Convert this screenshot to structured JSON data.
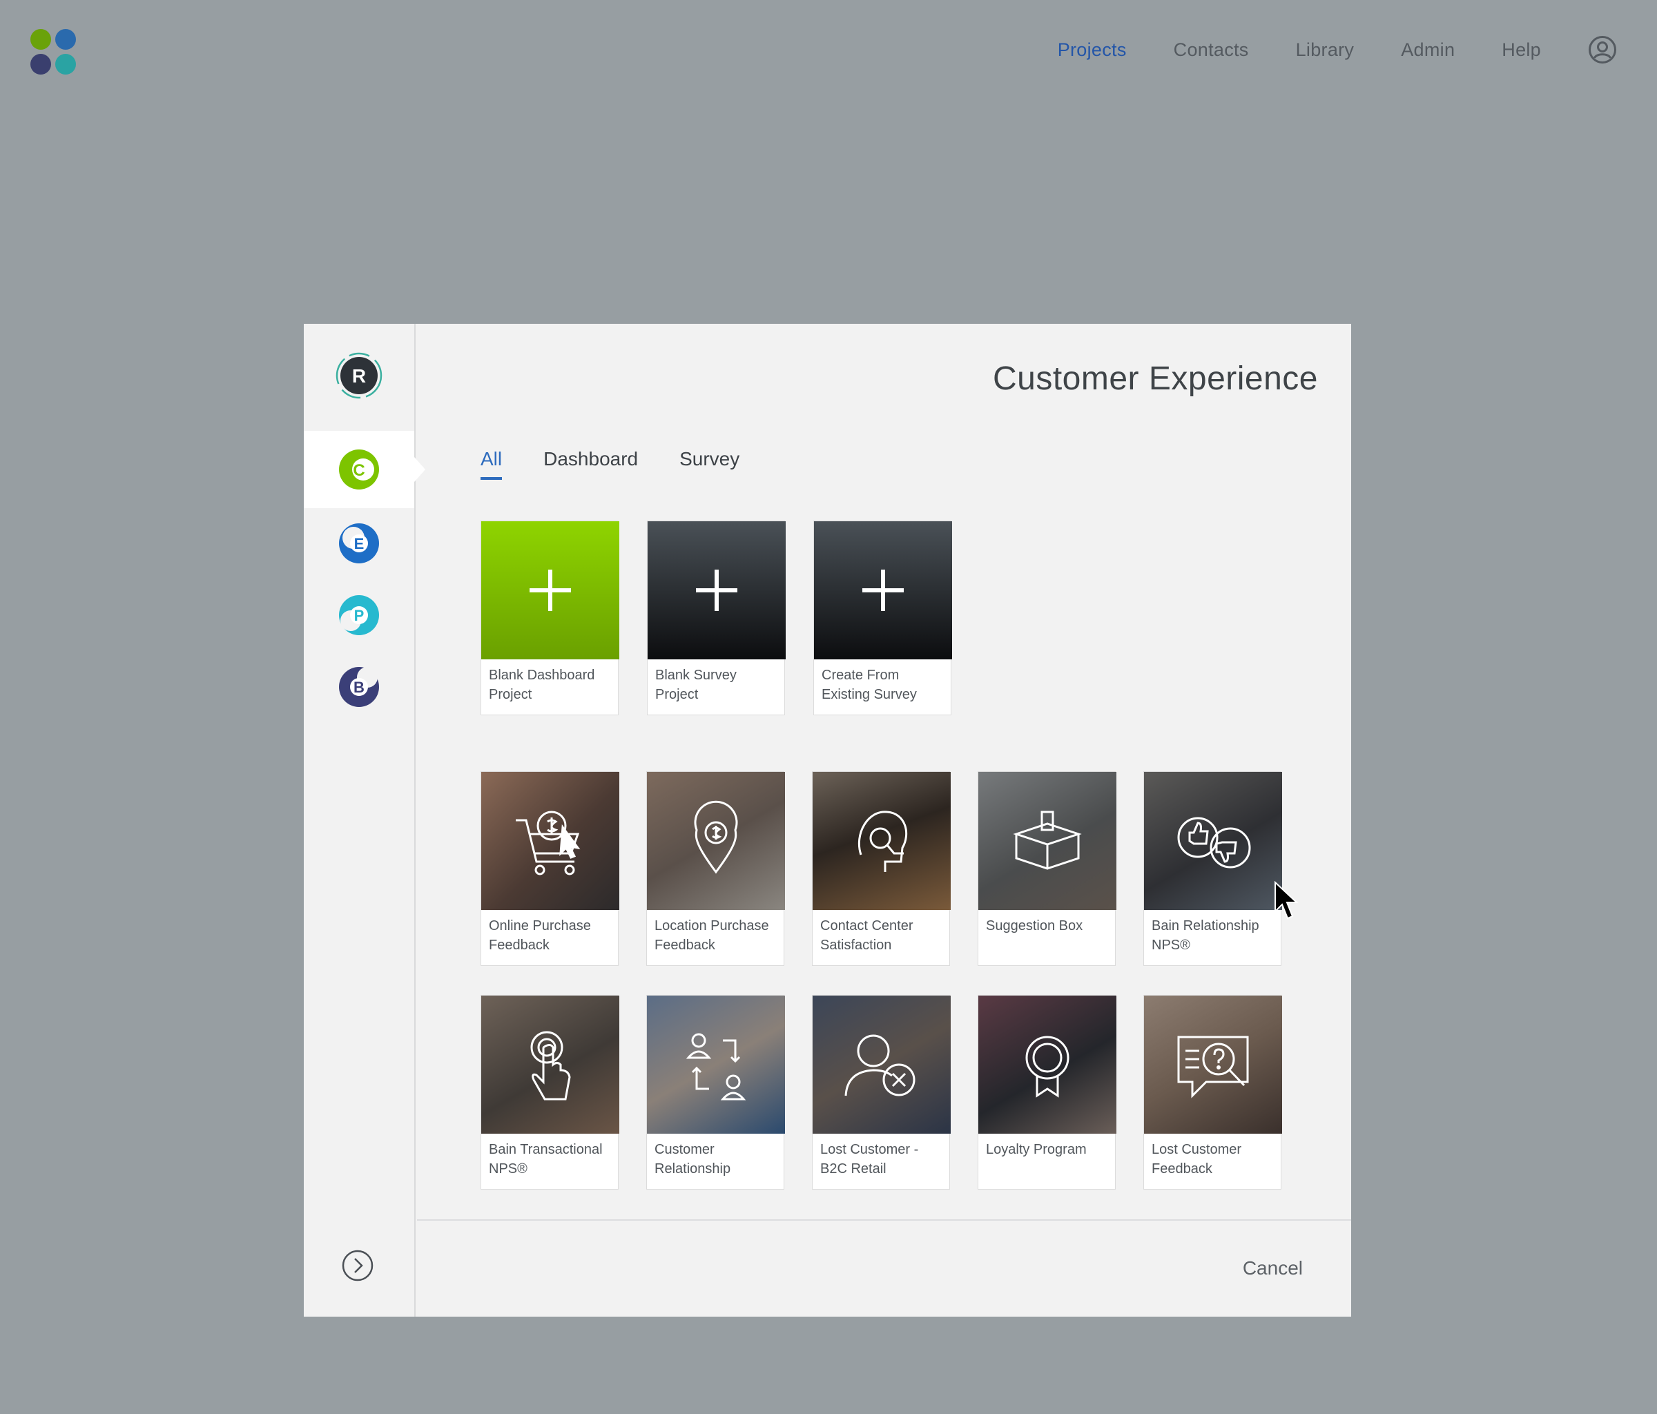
{
  "nav": {
    "items": [
      {
        "label": "Projects",
        "active": true
      },
      {
        "label": "Contacts"
      },
      {
        "label": "Library"
      },
      {
        "label": "Admin"
      },
      {
        "label": "Help"
      }
    ],
    "account_icon": "user-circle-icon"
  },
  "logo": {
    "colors": [
      "#6aa20a",
      "#2a6aad",
      "#3a3f6e",
      "#2aa3a3"
    ]
  },
  "sidebar": {
    "items": [
      {
        "letter": "R",
        "color": "#2d3238"
      },
      {
        "letter": "C",
        "color": "#7dc400",
        "selected": true
      },
      {
        "letter": "E",
        "color": "#1e6ec6"
      },
      {
        "letter": "P",
        "color": "#27b9cf"
      },
      {
        "letter": "B",
        "color": "#3b3f78"
      }
    ],
    "expand_icon": "chevron-right-circle-icon"
  },
  "modal": {
    "title": "Customer Experience",
    "tabs": [
      "All",
      "Dashboard",
      "Survey"
    ],
    "active_tab": "All",
    "blank_cards": [
      {
        "label": "Blank Dashboard\nProject",
        "icon": "plus-icon",
        "style": "green"
      },
      {
        "label": "Blank Survey\nProject",
        "icon": "plus-icon",
        "style": "dark"
      },
      {
        "label": "Create From\nExisting Survey",
        "icon": "plus-icon",
        "style": "dark"
      }
    ],
    "template_cards": [
      {
        "label": "Online Purchase\nFeedback",
        "icon": "shopping-cart-dollar-icon"
      },
      {
        "label": "Location Purchase\nFeedback",
        "icon": "location-dollar-icon"
      },
      {
        "label": "Contact Center\nSatisfaction",
        "icon": "headset-icon"
      },
      {
        "label": "Suggestion Box",
        "icon": "ballot-box-icon"
      },
      {
        "label": "Bain Relationship\nNPS®",
        "icon": "thumbs-up-down-icon"
      },
      {
        "label": "Bain Transactional\nNPS®",
        "icon": "touch-icon"
      },
      {
        "label": "Customer\nRelationship",
        "icon": "user-exchange-icon"
      },
      {
        "label": "Lost Customer -\nB2C Retail",
        "icon": "user-remove-icon"
      },
      {
        "label": "Loyalty Program",
        "icon": "award-ribbon-icon"
      },
      {
        "label": "Lost Customer\nFeedback",
        "icon": "chat-question-search-icon"
      }
    ],
    "cancel_label": "Cancel"
  }
}
